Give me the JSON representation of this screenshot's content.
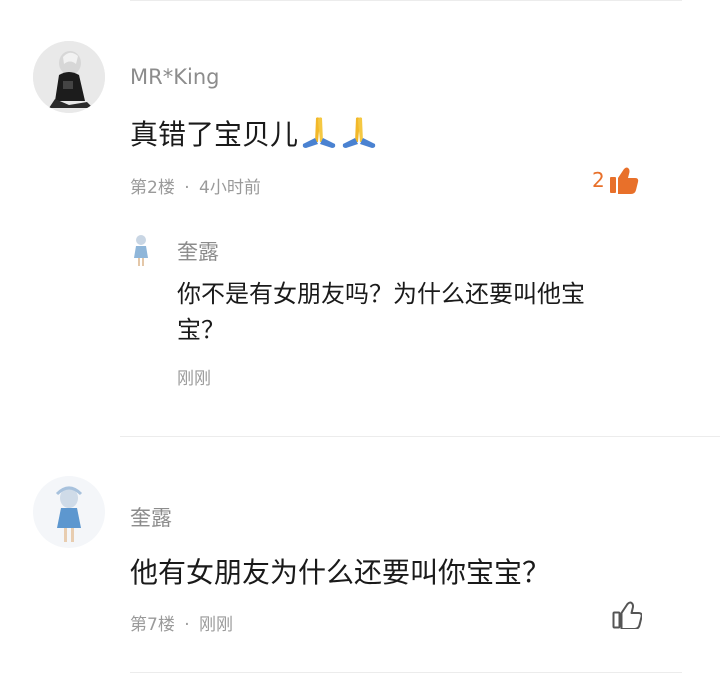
{
  "comments": [
    {
      "username": "MR*King",
      "text": "真错了宝贝儿",
      "emojis": [
        "folded-hands-emoji",
        "folded-hands-emoji"
      ],
      "floor": "第2楼",
      "time": "4小时前",
      "likes": "2",
      "liked": true,
      "reply": {
        "username": "奎露",
        "text_line1": "你不是有女朋友吗？为什么还要叫他宝",
        "text_line2": "宝？",
        "time": "刚刚"
      }
    },
    {
      "username": "奎露",
      "text": "他有女朋友为什么还要叫你宝宝？",
      "floor": "第7楼",
      "time": "刚刚",
      "liked": false
    }
  ],
  "separator": "·",
  "colors": {
    "like_active": "#e8702a",
    "muted_text": "#8c8c8c",
    "divider": "#ececec"
  }
}
